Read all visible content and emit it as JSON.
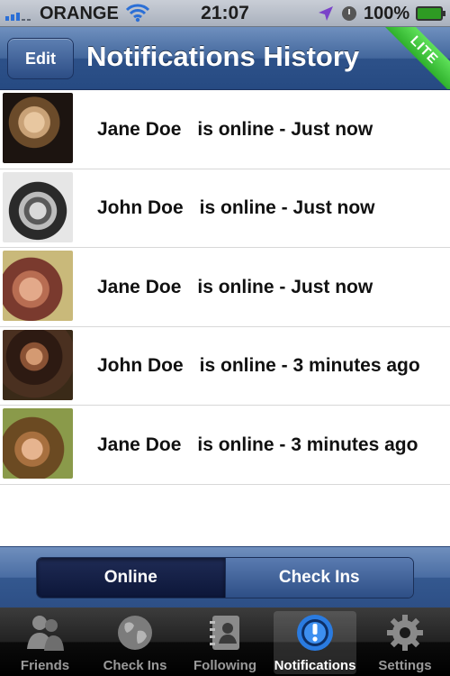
{
  "status_bar": {
    "carrier": "ORANGE",
    "time": "21:07",
    "battery": "100%"
  },
  "nav": {
    "edit_label": "Edit",
    "title": "Notifications History",
    "ribbon": "LITE"
  },
  "notifications": [
    {
      "name": "Jane Doe",
      "message": "is online - Just now"
    },
    {
      "name": "John Doe",
      "message": "is online - Just now"
    },
    {
      "name": "Jane Doe",
      "message": "is online - Just now"
    },
    {
      "name": "John Doe",
      "message": "is online - 3 minutes ago"
    },
    {
      "name": "Jane Doe",
      "message": "is online - 3 minutes ago"
    }
  ],
  "segmented": {
    "options": [
      "Online",
      "Check Ins"
    ],
    "selected": "Online"
  },
  "tabs": [
    {
      "label": "Friends",
      "icon": "friends-icon"
    },
    {
      "label": "Check Ins",
      "icon": "globe-icon"
    },
    {
      "label": "Following",
      "icon": "address-book-icon"
    },
    {
      "label": "Notifications",
      "icon": "exclamation-icon"
    },
    {
      "label": "Settings",
      "icon": "gear-icon"
    }
  ],
  "selected_tab": "Notifications"
}
